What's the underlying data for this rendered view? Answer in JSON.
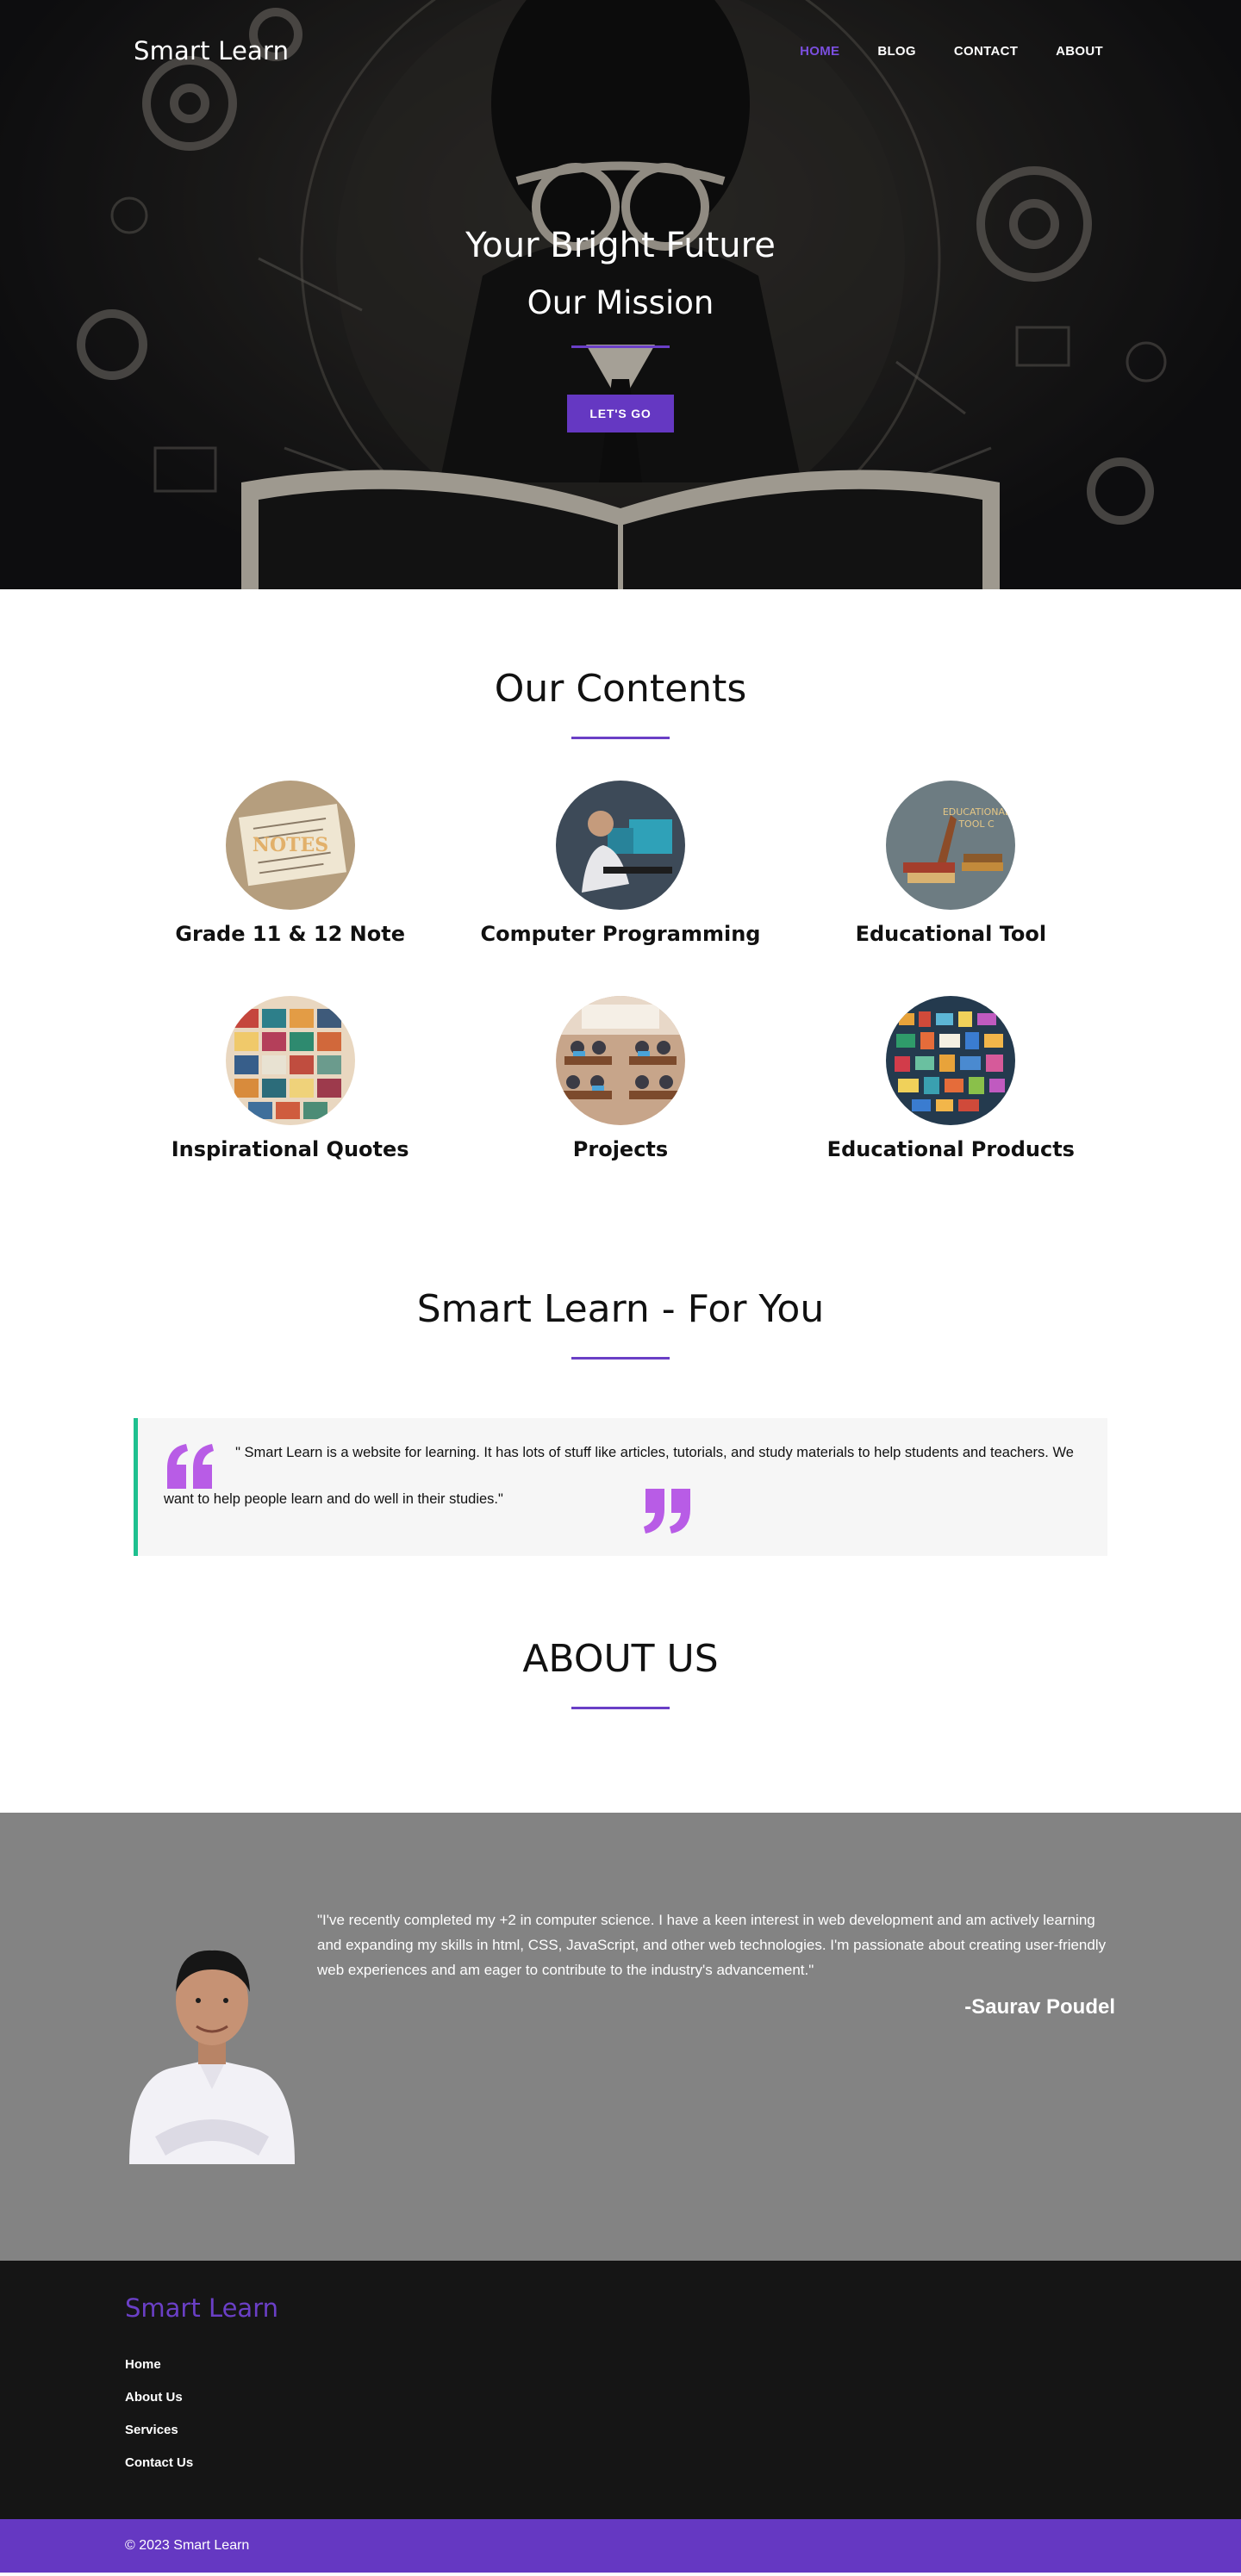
{
  "header": {
    "brand": "Smart Learn",
    "nav": [
      {
        "label": "HOME",
        "active": true
      },
      {
        "label": "BLOG",
        "active": false
      },
      {
        "label": "CONTACT",
        "active": false
      },
      {
        "label": "ABOUT",
        "active": false
      }
    ]
  },
  "hero": {
    "title": "Your Bright Future",
    "subtitle": "Our Mission",
    "cta_label": "LET'S GO"
  },
  "contents": {
    "title": "Our Contents",
    "items": [
      {
        "title": "Grade 11 & 12 Note",
        "image": "notes-image"
      },
      {
        "title": "Computer Programming",
        "image": "programmer-image"
      },
      {
        "title": "Educational Tool",
        "image": "educational-tool-image"
      },
      {
        "title": "Inspirational Quotes",
        "image": "quotes-image"
      },
      {
        "title": "Projects",
        "image": "classroom-image"
      },
      {
        "title": "Educational Products",
        "image": "products-image"
      }
    ]
  },
  "foryou": {
    "title": "Smart Learn - For You",
    "quote": "\" Smart Learn is a website for learning. It has lots of stuff like articles, tutorials, and study materials to help students and teachers. We want to help people learn and do well in their studies.\""
  },
  "about": {
    "title": "ABOUT US",
    "text": "\"I've recently completed my +2 in computer science. I have a keen interest in web development and am actively learning and expanding my skills in html, CSS, JavaScript, and other web technologies. I'm passionate about creating user-friendly web experiences and am eager to contribute to the industry's advancement.\"",
    "author": "-Saurav Poudel"
  },
  "footer": {
    "brand": "Smart Learn",
    "links": [
      "Home",
      "About Us",
      "Services",
      "Contact Us"
    ],
    "copyright": "© 2023 Smart Learn"
  },
  "colors": {
    "accent": "#6538c2",
    "quote_mark": "#b85ce6",
    "quote_border": "#1ec08f",
    "about_bg": "#838383",
    "footer_bg": "#151515"
  }
}
